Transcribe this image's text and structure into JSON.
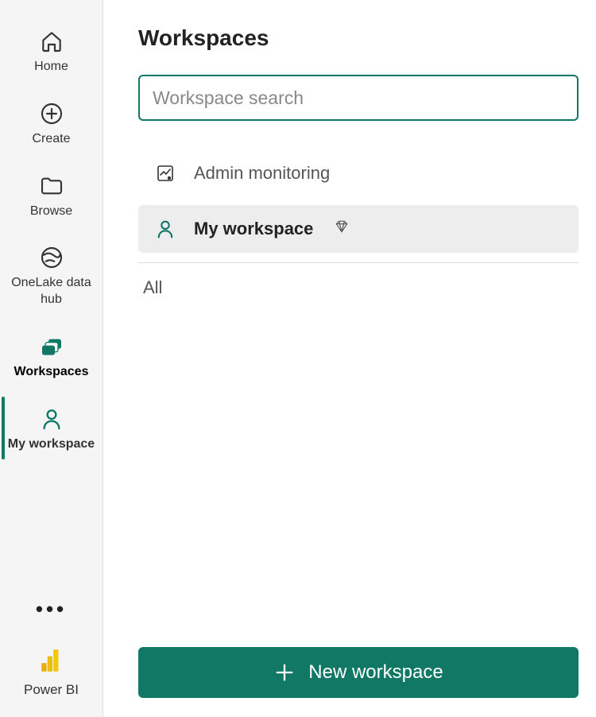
{
  "sidebar": {
    "items": [
      {
        "label": "Home"
      },
      {
        "label": "Create"
      },
      {
        "label": "Browse"
      },
      {
        "label": "OneLake data hub"
      },
      {
        "label": "Workspaces"
      },
      {
        "label": "My workspace"
      }
    ],
    "brand_label": "Power BI"
  },
  "panel": {
    "title": "Workspaces",
    "search_placeholder": "Workspace search",
    "items": [
      {
        "label": "Admin monitoring"
      },
      {
        "label": "My workspace"
      }
    ],
    "section_label": "All",
    "new_button_label": "New workspace"
  },
  "colors": {
    "accent": "#117865"
  }
}
